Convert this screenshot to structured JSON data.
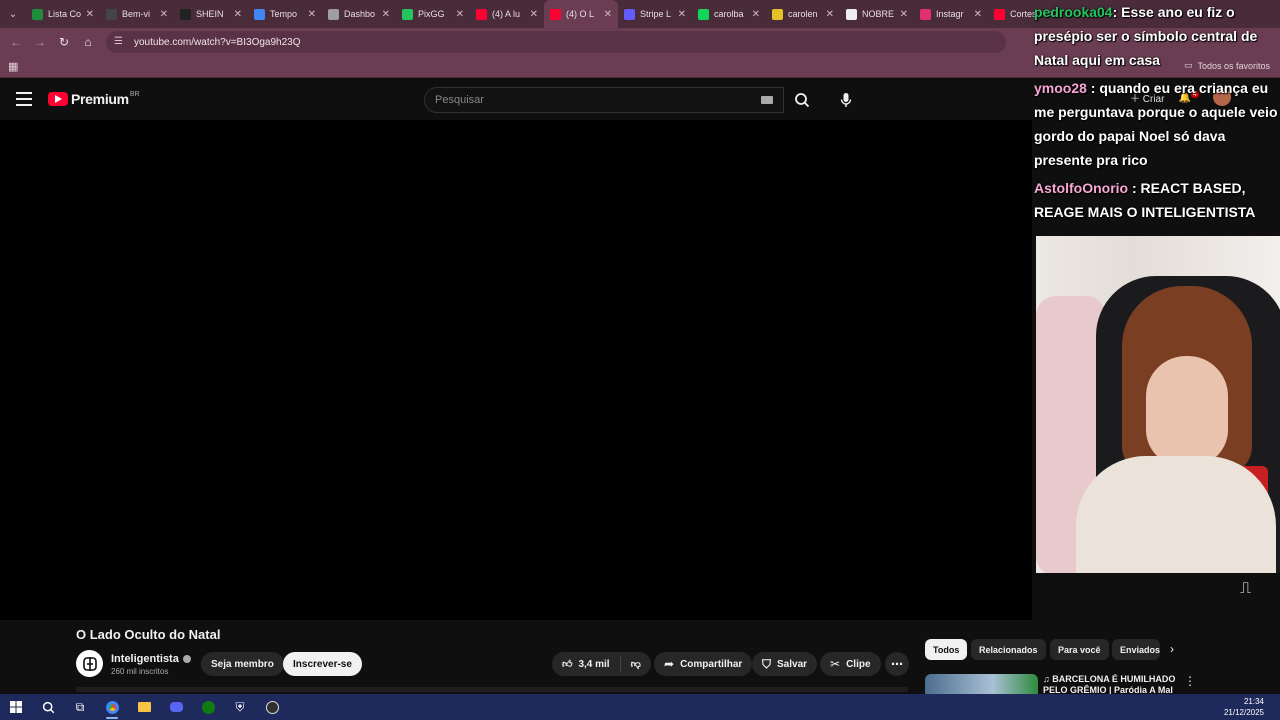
{
  "browser": {
    "tabs": [
      {
        "label": "Lista Co",
        "color": "#1e8e3e"
      },
      {
        "label": "Bem-vi",
        "color": "#444444"
      },
      {
        "label": "SHEIN",
        "color": "#222222"
      },
      {
        "label": "Tempo",
        "color": "#4285f4"
      },
      {
        "label": "Dashbo",
        "color": "#9e9e9e"
      },
      {
        "label": "PixGG",
        "color": "#22c55e"
      },
      {
        "label": "(4) A lu",
        "color": "#ff0033"
      },
      {
        "label": "(4) O L",
        "color": "#ff0033",
        "active": true
      },
      {
        "label": "Stripe L",
        "color": "#635bff"
      },
      {
        "label": "carolba",
        "color": "#12d65a"
      },
      {
        "label": "carolen",
        "color": "#e6c229"
      },
      {
        "label": "NOBRE",
        "color": "#eeeeee"
      },
      {
        "label": "Instagr",
        "color": "#e1306c"
      },
      {
        "label": "Cortes",
        "color": "#ff0033"
      }
    ],
    "address": "youtube.com/watch?v=BI3Oga9h23Q",
    "bookmarks_all": "Todos os favoritos"
  },
  "youtube": {
    "logo_text": "Premium",
    "region": "BR",
    "search_placeholder": "Pesquisar",
    "create_label": "Criar",
    "notifications_count": "4"
  },
  "chat": [
    {
      "user": "pedrooka04",
      "user_color": "#22c55e",
      "text": ": Esse ano eu fiz o presépio ser o símbolo central de Natal aqui em casa"
    },
    {
      "user": "ymoo28",
      "user_color": "#f6a6d6",
      "text": " : quando eu era criança eu me perguntava porque o aquele veio gordo do papai Noel só dava presente pra rico"
    },
    {
      "user": "AstolfoOnorio",
      "user_color": "#f9a8d4",
      "text": " : REACT BASED, REAGE MAIS O INTELIGENTISTA"
    }
  ],
  "video": {
    "title": "O Lado Oculto do Natal",
    "channel": "Inteligentista",
    "subscribers": "260 mil inscritos",
    "member_label": "Seja membro",
    "subscribe_label": "Inscrever-se",
    "likes": "3,4 mil",
    "share_label": "Compartilhar",
    "save_label": "Salvar",
    "clip_label": "Clipe"
  },
  "chips": [
    "Todos",
    "Relacionados",
    "Para você",
    "Enviados"
  ],
  "recommendation": {
    "title": "♫ BARCELONA É HUMILHADO PELO GRÊMIO | Paródia A Mal"
  },
  "system": {
    "time": "21:34",
    "date": "21/12/2025"
  }
}
